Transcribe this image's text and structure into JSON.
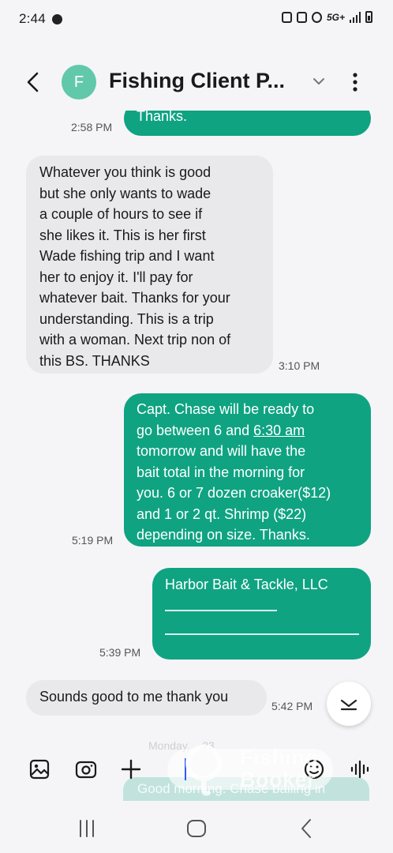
{
  "status_bar": {
    "time": "2:44",
    "network": "5G+"
  },
  "header": {
    "avatar_letter": "F",
    "title": "Fishing Client P..."
  },
  "messages": [
    {
      "dir": "out",
      "text": "Thanks.",
      "time": "2:58 PM"
    },
    {
      "dir": "in",
      "text": "Whatever you think is good\nbut she only wants to wade\na couple of hours to see if\nshe likes it. This is her first\nWade fishing trip and I want\nher to enjoy it. I'll pay for\nwhatever bait. Thanks for your\nunderstanding. This is a trip\nwith a woman. Next trip non of\nthis BS. THANKS",
      "time": "3:10 PM"
    },
    {
      "dir": "out",
      "text_before": "Capt. Chase will be ready to\ngo between 6 and ",
      "link": "6:30 am",
      "text_after": "\ntomorrow and will have the\nbait total in the morning for\nyou. 6 or 7 dozen croaker($12)\nand 1 or 2 qt. Shrimp ($22)\ndepending on size. Thanks.",
      "time": "5:19 PM"
    },
    {
      "dir": "out",
      "text": "Harbor Bait & Tackle, LLC",
      "time": "5:39 PM"
    },
    {
      "dir": "in",
      "text": "Sounds good to me thank you",
      "time": "5:42 PM"
    }
  ],
  "ghost": {
    "date": "Monday, ...23",
    "preview": "Good morning. Chase bailing in"
  },
  "watermark": {
    "line1": "Fishing",
    "line2": "Booker"
  },
  "colors": {
    "accent": "#0fa382",
    "incoming": "#e9e9ec",
    "avatar": "#62c8aa"
  }
}
